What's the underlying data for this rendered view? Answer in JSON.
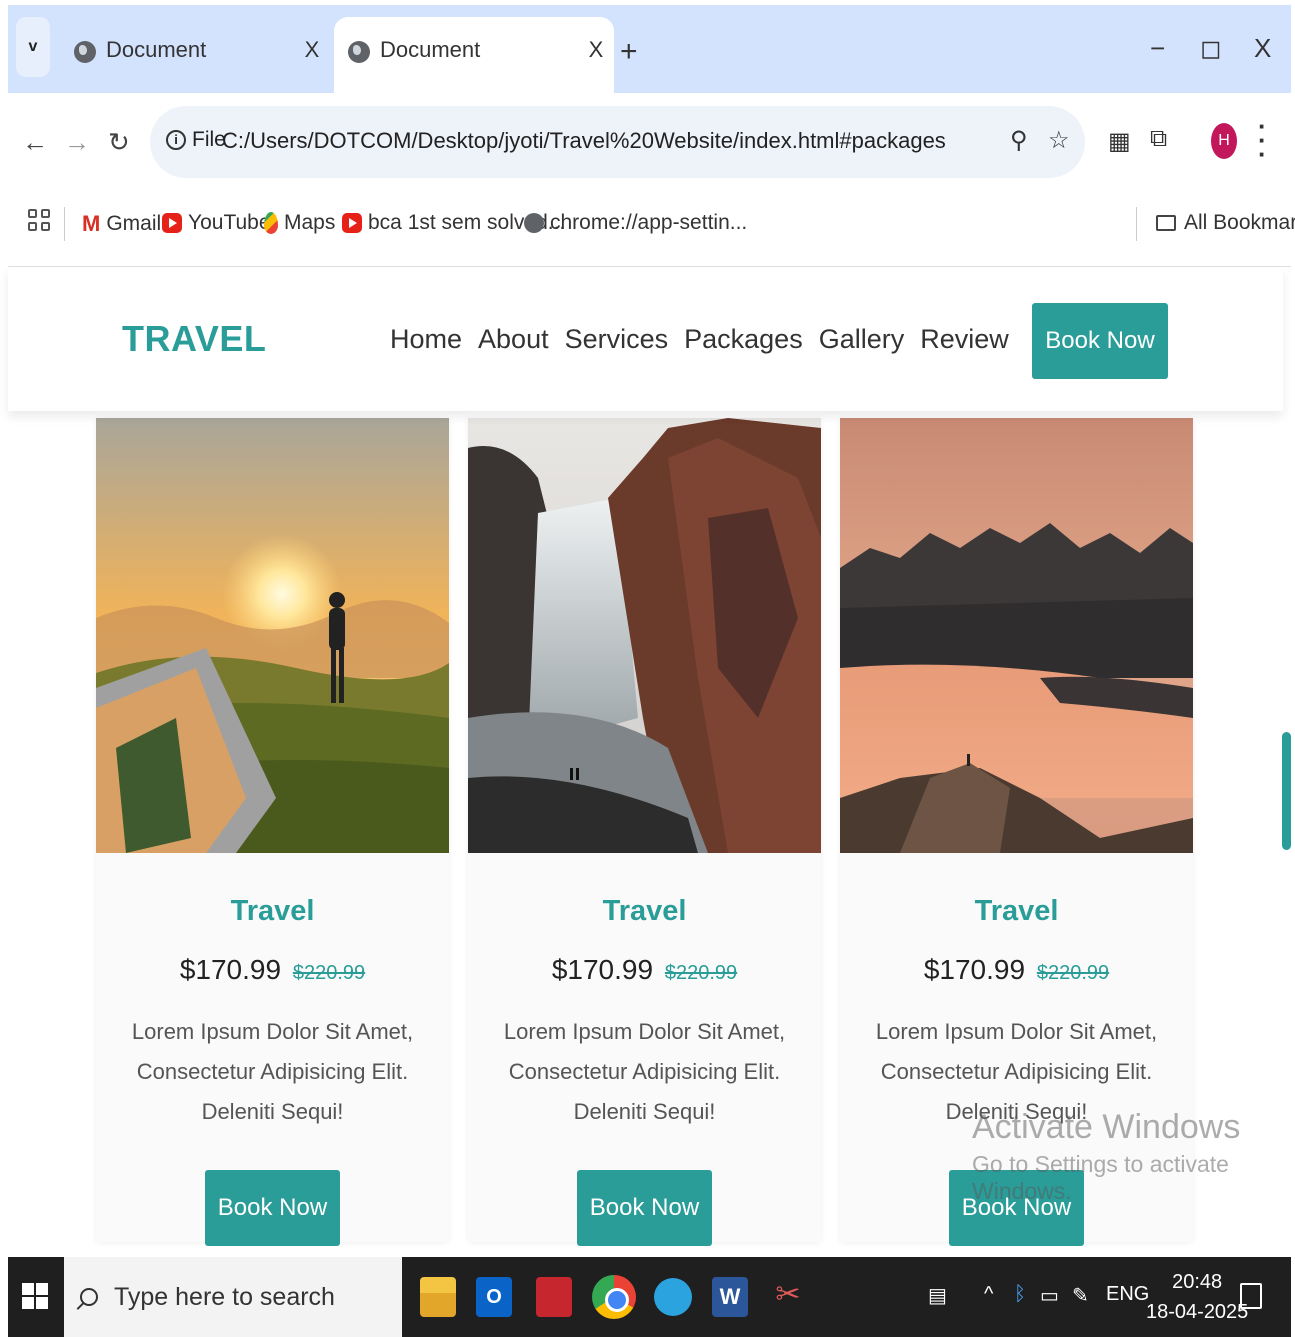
{
  "browser": {
    "tabs": [
      {
        "title": "Document",
        "close": "X"
      },
      {
        "title": "Document",
        "close": "X"
      }
    ],
    "new_tab": "+",
    "window_controls": {
      "minimize": "−",
      "restore": "◻",
      "close": "X"
    },
    "tab_list_icon": "v",
    "omnibox": {
      "info_icon": "i",
      "scheme_label": "File",
      "url": "C:/Users/DOTCOM/Desktop/jyoti/Travel%20Website/index.html#packages"
    },
    "profile_initial": "H",
    "bookmarks": [
      {
        "label": "Gmail",
        "icon": "gmail-icon"
      },
      {
        "label": "YouTube",
        "icon": "youtube-icon"
      },
      {
        "label": "Maps",
        "icon": "maps-icon"
      },
      {
        "label": "bca 1st sem solved...",
        "icon": "youtube-icon"
      },
      {
        "label": "chrome://app-settin...",
        "icon": "globe-icon"
      }
    ],
    "all_bookmarks": "All Bookmarks"
  },
  "site": {
    "logo": "TRAVEL",
    "nav": [
      "Home",
      "About",
      "Services",
      "Packages",
      "Gallery",
      "Review"
    ],
    "header_button": "Book Now",
    "accent_color": "#2a9d99",
    "cards": [
      {
        "image": "sunset-hiker-tent",
        "title": "Travel",
        "price": "$170.99",
        "old_price": "$220.99",
        "description": "Lorem Ipsum Dolor Sit Amet, Consectetur Adipisicing Elit. Deleniti Sequi!",
        "button": "Book Now"
      },
      {
        "image": "waterfall-cliffs",
        "title": "Travel",
        "price": "$170.99",
        "old_price": "$220.99",
        "description": "Lorem Ipsum Dolor Sit Amet, Consectetur Adipisicing Elit. Deleniti Sequi!",
        "button": "Book Now"
      },
      {
        "image": "mountain-lake-dusk",
        "title": "Travel",
        "price": "$170.99",
        "old_price": "$220.99",
        "description": "Lorem Ipsum Dolor Sit Amet, Consectetur Adipisicing Elit. Deleniti Sequi!",
        "button": "Book Now"
      }
    ]
  },
  "watermark": {
    "line1": "Activate Windows",
    "line2": "Go to Settings to activate Windows."
  },
  "taskbar": {
    "search_placeholder": "Type here to search",
    "language": "ENG",
    "time": "20:48",
    "date": "18-04-2025"
  }
}
